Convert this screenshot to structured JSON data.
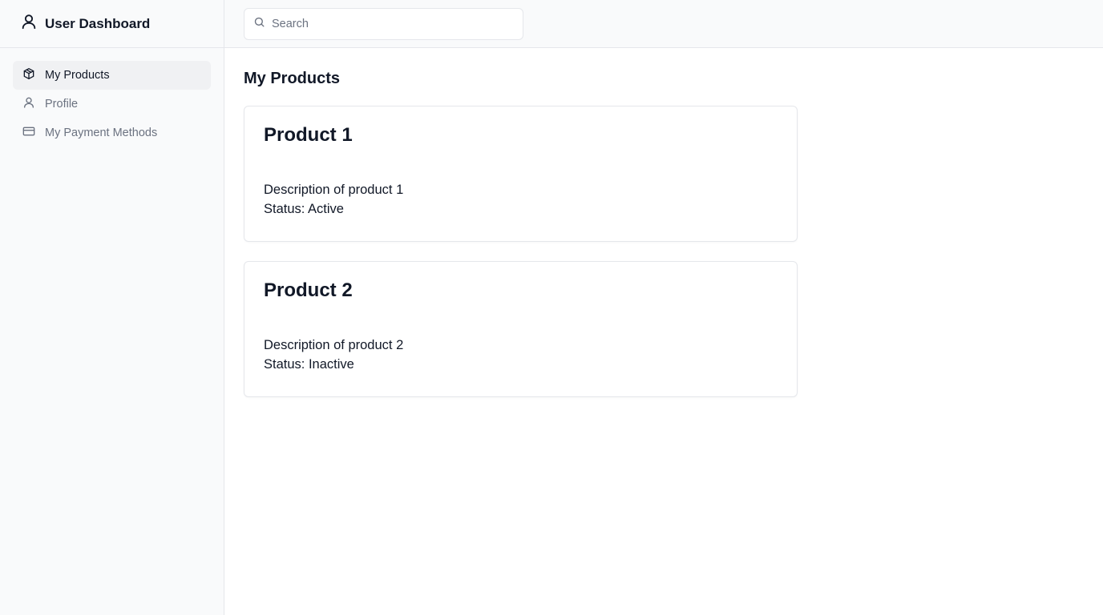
{
  "app": {
    "title": "User Dashboard",
    "brand_icon": "user-icon"
  },
  "sidebar": {
    "items": [
      {
        "label": "My Products",
        "icon": "package-icon",
        "active": true
      },
      {
        "label": "Profile",
        "icon": "user-icon",
        "active": false
      },
      {
        "label": "My Payment Methods",
        "icon": "credit-card-icon",
        "active": false
      }
    ]
  },
  "search": {
    "placeholder": "Search",
    "value": "",
    "icon": "search-icon"
  },
  "page": {
    "title": "My Products"
  },
  "products": [
    {
      "title": "Product 1",
      "description": "Description of product 1",
      "status": "Status: Active"
    },
    {
      "title": "Product 2",
      "description": "Description of product 2",
      "status": "Status: Inactive"
    }
  ],
  "colors": {
    "sidebar_bg": "#f9fafb",
    "active_item_bg": "#f0f1f3",
    "border": "#e5e7eb",
    "text_primary": "#111827",
    "text_muted": "#6b7280"
  }
}
